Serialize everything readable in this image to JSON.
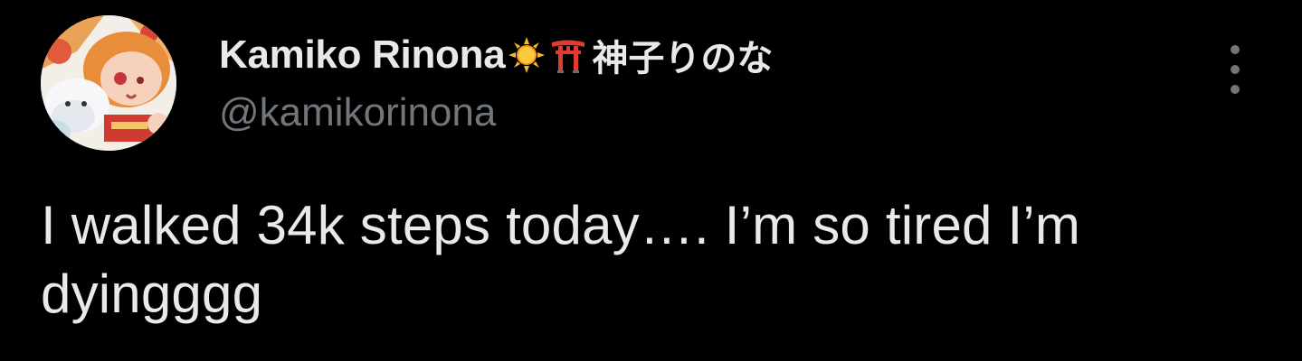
{
  "tweet": {
    "author": {
      "display_name": "Kamiko Rinona",
      "display_name_emoji": [
        "sun-icon",
        "torii-gate-icon"
      ],
      "display_name_jp": "神子りのな",
      "handle": "@kamikorinona",
      "avatar": "anime-girl-avatar"
    },
    "text": "I walked 34k steps today…. I’m so tired I’m dyingggg",
    "more_icon": "more-vertical-icon"
  },
  "colors": {
    "background": "#000000",
    "primary_text": "#e7e9ea",
    "secondary_text": "#71767b"
  }
}
